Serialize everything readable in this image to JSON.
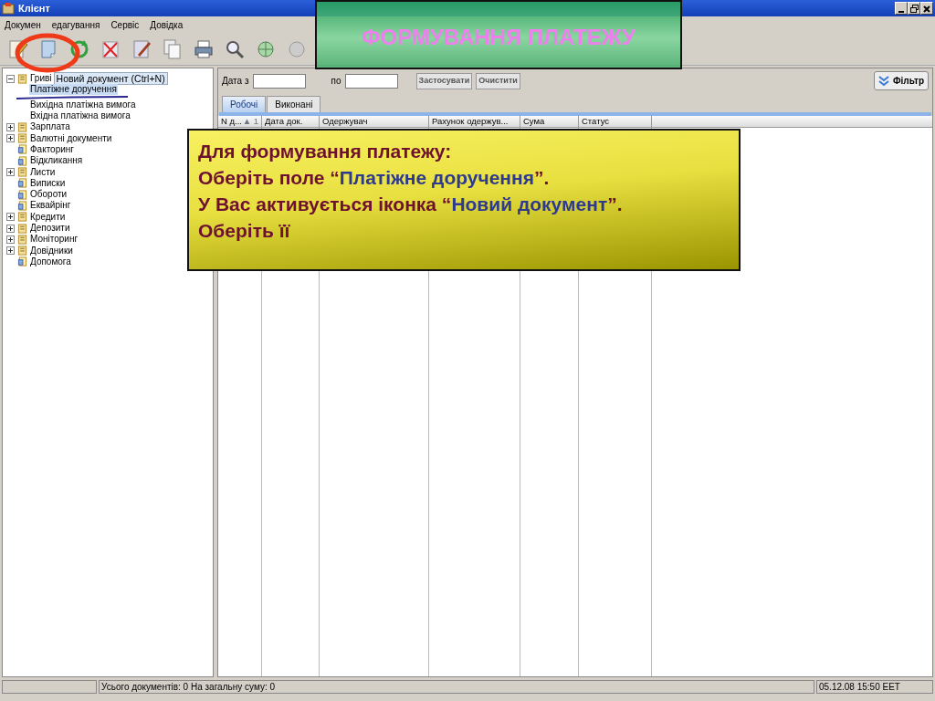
{
  "window": {
    "title": "Клієнт"
  },
  "menu": [
    "Докумен",
    "едагування",
    "Сервіс",
    "Довідка"
  ],
  "tooltip": "Новий документ (Ctrl+N)",
  "tree": [
    {
      "label": "Гриві",
      "kind": "group",
      "expanded": true,
      "children": [
        {
          "label": "Платіжне доручення",
          "selected": true
        },
        {
          "label": "Вихідна платіжна вимога",
          "selected": false
        },
        {
          "label": "Вхідна платіжна вимога",
          "selected": false
        }
      ]
    },
    {
      "label": "Зарплата",
      "kind": "group",
      "expanded": false
    },
    {
      "label": "Валютні документи",
      "kind": "group",
      "expanded": false
    },
    {
      "label": "Факторинг",
      "kind": "item"
    },
    {
      "label": "Відкликання",
      "kind": "item"
    },
    {
      "label": "Листи",
      "kind": "group",
      "expanded": false
    },
    {
      "label": "Виписки",
      "kind": "item"
    },
    {
      "label": "Обороти",
      "kind": "item"
    },
    {
      "label": "Еквайрінг",
      "kind": "item"
    },
    {
      "label": "Кредити",
      "kind": "group",
      "expanded": false
    },
    {
      "label": "Депозити",
      "kind": "group",
      "expanded": false
    },
    {
      "label": "Моніторинг",
      "kind": "group",
      "expanded": false
    },
    {
      "label": "Довідники",
      "kind": "group",
      "expanded": false
    },
    {
      "label": "Допомога",
      "kind": "item"
    }
  ],
  "filter": {
    "date_from_label": "Дата з",
    "date_to_label": "по",
    "apply_button": "Застосувати",
    "clear_button": "Очистити",
    "filter_button": "Фільтр"
  },
  "tabs": [
    {
      "label": "Робочі",
      "selected": true
    },
    {
      "label": "Виконані",
      "selected": false
    }
  ],
  "table": {
    "columns": [
      "N д...",
      "Дата док.",
      "Одержувач",
      "Рахунок одержув...",
      "Сума",
      "Статус"
    ],
    "sort_mark": "▲ 1"
  },
  "status_bar": {
    "summary": "Усього документів: 0 На загальну суму: 0",
    "datetime": "05.12.08 15:50 EET"
  },
  "banner": "ФОРМУВАННЯ ПЛАТЕЖУ",
  "callout": [
    [
      {
        "text": "Для формування платежу:",
        "highlight": false
      }
    ],
    [
      {
        "text": "Оберіть поле “",
        "highlight": false
      },
      {
        "text": "Платіжне доручення",
        "highlight": true
      },
      {
        "text": "”.",
        "highlight": false
      }
    ],
    [
      {
        "text": "У Вас активується іконка “",
        "highlight": false
      },
      {
        "text": "Новий документ",
        "highlight": true
      },
      {
        "text": "”.",
        "highlight": false
      }
    ],
    [
      {
        "text": "Оберіть її",
        "highlight": false
      }
    ]
  ]
}
